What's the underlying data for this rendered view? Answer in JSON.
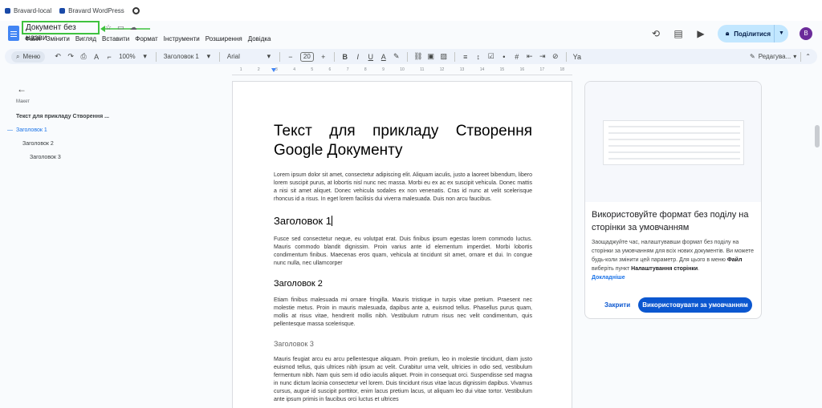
{
  "bookmarks": [
    {
      "label": "Bravard-local"
    },
    {
      "label": "Bravard WordPress"
    }
  ],
  "header": {
    "doc_title": "Документ без назви",
    "menu": [
      "Файл",
      "Змінити",
      "Вигляд",
      "Вставити",
      "Формат",
      "Інструменти",
      "Розширення",
      "Довідка"
    ],
    "share_label": "Поділитися",
    "avatar_letter": "B"
  },
  "toolbar": {
    "search_label": "Меню",
    "zoom": "100%",
    "style": "Заголовок 1",
    "font": "Arial",
    "font_size": "20",
    "mode_label": "Редагува..."
  },
  "ruler": [
    "1",
    "2",
    "3",
    "4",
    "5",
    "6",
    "7",
    "8",
    "9",
    "10",
    "11",
    "12",
    "13",
    "14",
    "15",
    "16",
    "17",
    "18"
  ],
  "outline": {
    "section_label": "Макет",
    "items": [
      {
        "label": "Текст для прикладу Створення ..."
      },
      {
        "label": "Заголовок 1"
      },
      {
        "label": "Заголовок 2"
      },
      {
        "label": "Заголовок 3"
      }
    ]
  },
  "document": {
    "title": "Текст для прикладу Створення Google Документу",
    "p1": "Lorem ipsum dolor sit amet, consectetur adipiscing elit. Aliquam iaculis, justo a laoreet bibendum, libero lorem suscipit purus, at lobortis nisl nunc nec massa. Morbi eu ex ac ex suscipit vehicula. Donec mattis a nisi sit amet aliquet. Donec vehicula sodales ex non venenatis. Cras id nunc at velit scelerisque rhoncus id a risus. In eget lorem facilisis dui viverra malesuada. Duis non arcu faucibus.",
    "h1": "Заголовок 1",
    "p2": "Fusce sed consectetur neque, eu volutpat erat. Duis finibus ipsum egestas lorem commodo luctus. Mauris commodo blandit dignissim. Proin varius ante id elementum imperdiet. Morbi lobortis condimentum finibus. Maecenas eros quam, vehicula at tincidunt sit amet, ornare et dui. In congue nunc nulla, nec ullamcorper",
    "h2": "Заголовок 2",
    "p3": "Etiam finibus malesuada mi ornare fringilla. Mauris tristique in turpis vitae pretium. Praesent nec molestie metus. Proin in mauris malesuada, dapibus ante a, euismod tellus. Phasellus purus quam, mollis at risus vitae, hendrerit mollis nibh. Vestibulum rutrum risus nec velit condimentum, quis pellentesque massa scelerisque.",
    "h3": "Заголовок 3",
    "p4": "Mauris feugiat arcu eu arcu pellentesque aliquam. Proin pretium, leo in molestie tincidunt, diam justo euismod tellus, quis ultrices nibh ipsum ac velit. Curabitur urna velit, ultricies in odio sed, vestibulum fermentum nibh. Nam quis sem id odio iaculis aliquet. Proin in consequat orci. Suspendisse sed magna in nunc dictum lacinia consectetur vel lorem. Duis tincidunt risus vitae lacus dignissim dapibus. Vivamus cursus, augue id suscipit porttitor, enim lacus pretium lacus, ut aliquam leo dui vitae tortor. Vestibulum ante ipsum primis in faucibus orci luctus et ultrices"
  },
  "card": {
    "heading": "Використовуйте формат без поділу на сторінки за умовчанням",
    "text_a": "Заощаджуйте час, налаштувавши формат без поділу на сторінки за умовчанням для всіх нових документів. Ви можете будь-коли змінити цей параметр. Для цього в меню ",
    "text_b": "Файл",
    "text_c": " виберіть пункт ",
    "text_d": "Налаштування сторінки",
    "text_e": ".",
    "link": "Докладніше",
    "close_label": "Закрити",
    "use_label": "Використовувати за умовчанням"
  }
}
